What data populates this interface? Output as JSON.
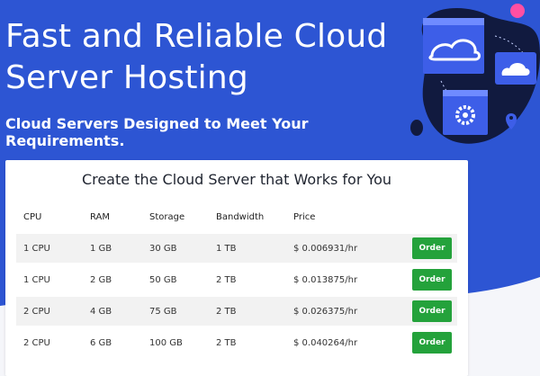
{
  "hero": {
    "title": "Fast and Reliable Cloud Server Hosting",
    "subtitle": "Cloud Servers Designed to Meet Your Requirements."
  },
  "colors": {
    "hero_bg": "#2d55d3",
    "order_button": "#24a23b",
    "illustration_blob": "#111a3f",
    "accent_pink": "#ff4fa3"
  },
  "card": {
    "title": "Create the Cloud Server that Works for You",
    "columns": [
      "CPU",
      "RAM",
      "Storage",
      "Bandwidth",
      "Price"
    ],
    "rows": [
      {
        "cpu": "1 CPU",
        "ram": "1 GB",
        "storage": "30 GB",
        "bandwidth": "1 TB",
        "price": "$ 0.006931/hr",
        "action": "Order"
      },
      {
        "cpu": "1 CPU",
        "ram": "2 GB",
        "storage": "50 GB",
        "bandwidth": "2 TB",
        "price": "$ 0.013875/hr",
        "action": "Order"
      },
      {
        "cpu": "2 CPU",
        "ram": "4 GB",
        "storage": "75 GB",
        "bandwidth": "2 TB",
        "price": "$ 0.026375/hr",
        "action": "Order"
      },
      {
        "cpu": "2 CPU",
        "ram": "6 GB",
        "storage": "100 GB",
        "bandwidth": "2 TB",
        "price": "$ 0.040264/hr",
        "action": "Order"
      }
    ]
  },
  "illustration": {
    "icons": [
      "cloud-window-icon",
      "cloud-icon",
      "gear-icon",
      "location-pin-icon"
    ]
  }
}
